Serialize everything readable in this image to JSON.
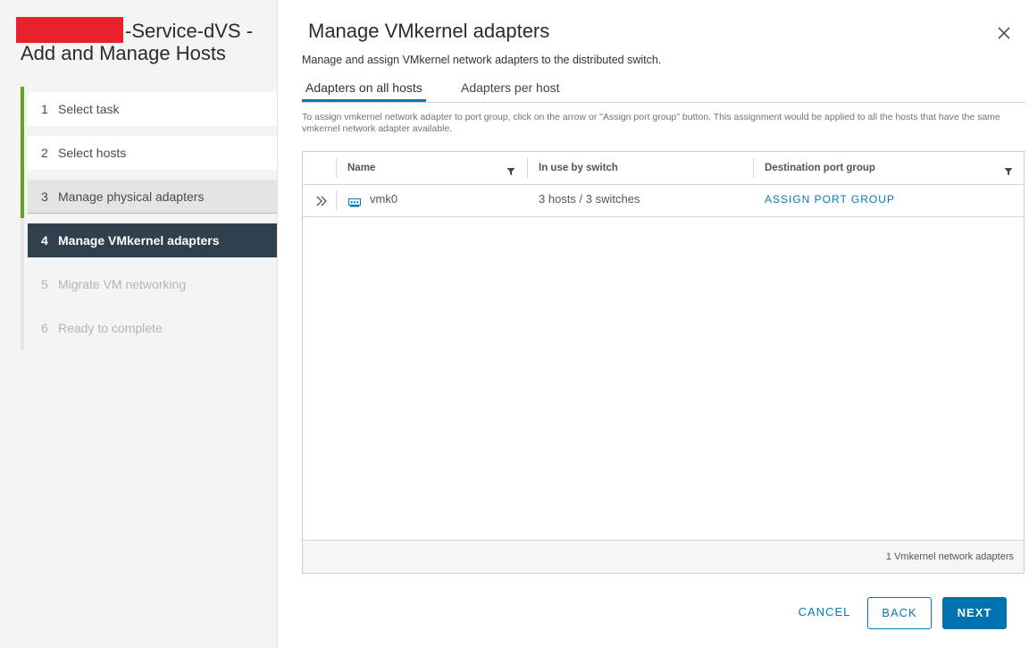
{
  "wizard": {
    "title_line1": "-Service-dVS -",
    "title_line2": "Add and Manage Hosts",
    "steps": [
      {
        "num": "1",
        "label": "Select task"
      },
      {
        "num": "2",
        "label": "Select hosts"
      },
      {
        "num": "3",
        "label": "Manage physical adapters"
      },
      {
        "num": "4",
        "label": "Manage VMkernel adapters"
      },
      {
        "num": "5",
        "label": "Migrate VM networking"
      },
      {
        "num": "6",
        "label": "Ready to complete"
      }
    ]
  },
  "main": {
    "title": "Manage VMkernel adapters",
    "subtitle": "Manage and assign VMkernel network adapters to the distributed switch.",
    "tabs": [
      {
        "label": "Adapters on all hosts"
      },
      {
        "label": "Adapters per host"
      }
    ],
    "hint": "To assign vmkernel network adapter to port group, click on the arrow or \"Assign port group\" button. This assignment would be applied to all the hosts that have the same vmkernel network adapter available."
  },
  "grid": {
    "columns": [
      "Name",
      "In use by switch",
      "Destination port group"
    ],
    "rows": [
      {
        "name": "vmk0",
        "in_use": "3 hosts / 3 switches",
        "action": "ASSIGN PORT GROUP"
      }
    ],
    "footer": "1 Vmkernel network adapters"
  },
  "buttons": {
    "cancel": "CANCEL",
    "back": "BACK",
    "next": "NEXT"
  },
  "icons": {
    "close": "close-icon",
    "filter": "filter-icon",
    "expand": "chevron-double-right-icon",
    "nic": "network-adapter-icon"
  },
  "colors": {
    "accent": "#0079b8",
    "progress": "#62a420",
    "active_step": "#2f3f4c",
    "redaction": "#e8212b"
  }
}
